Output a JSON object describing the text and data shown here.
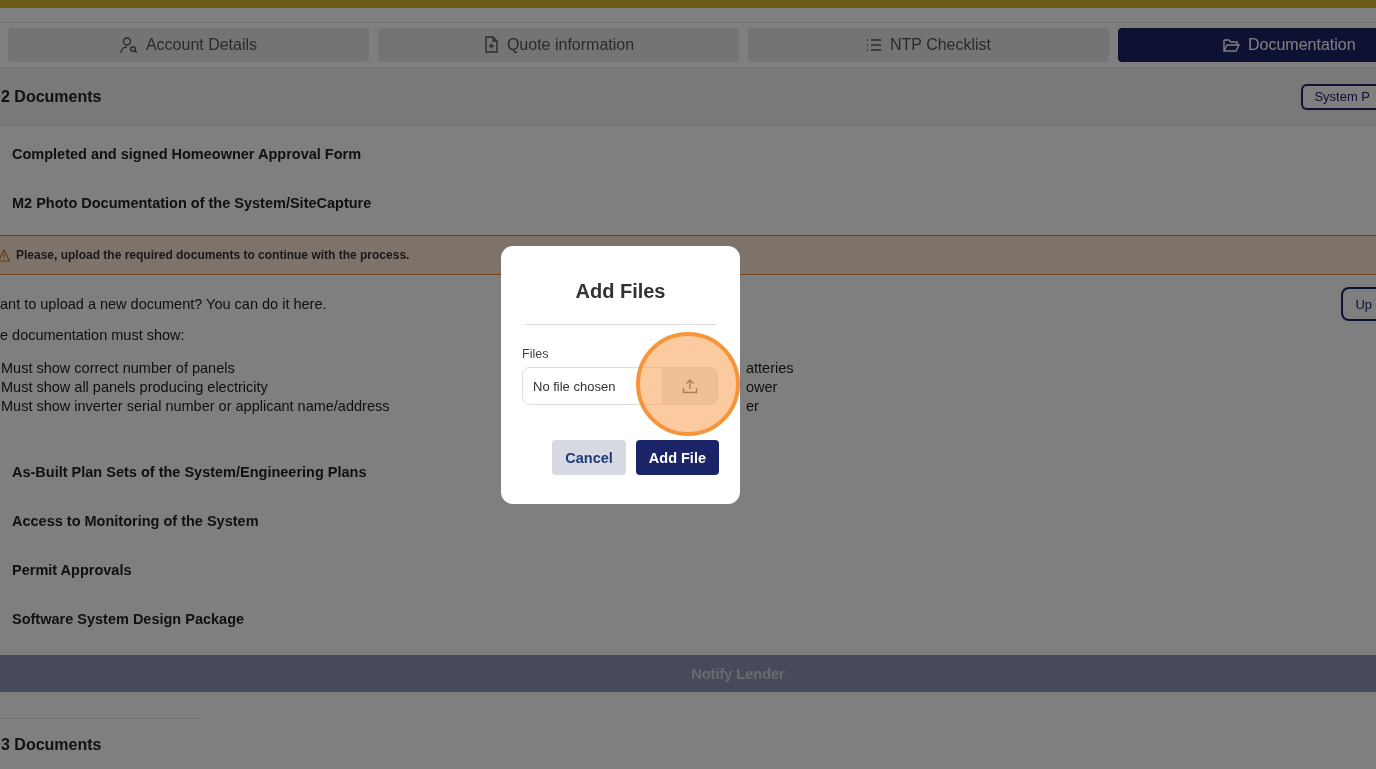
{
  "tabs": [
    {
      "label": "Account Details",
      "selected": false
    },
    {
      "label": "Quote information",
      "selected": false
    },
    {
      "label": "NTP Checklist",
      "selected": false
    },
    {
      "label": "Documentation",
      "selected": true
    }
  ],
  "section": {
    "title": "2 Documents",
    "action_button": "System P"
  },
  "documents": [
    "Completed and signed Homeowner Approval Form",
    "M2 Photo Documentation of the System/SiteCapture"
  ],
  "warning": "Please, upload the required documents to continue with the process.",
  "upload_prompt": "ant to upload a new document? You can do it here.",
  "upload_button": "Up",
  "requirements_title": "e documentation must show:",
  "requirements_left": [
    "Must show correct number of panels",
    "Must show all panels producing electricity",
    "Must show inverter serial number or applicant name/address"
  ],
  "requirements_right": [
    "atteries",
    "ower",
    "er"
  ],
  "more_documents": [
    "As-Built Plan Sets of the System/Engineering Plans",
    "Access to Monitoring of the System",
    "Permit Approvals",
    "Software System Design Package"
  ],
  "notify_button": {
    "label": "Notify Lender",
    "disabled": true
  },
  "next_section": {
    "title": "3 Documents"
  },
  "modal": {
    "title": "Add Files",
    "field_label": "Files",
    "file_status": "No file chosen",
    "buttons": [
      {
        "label": "Cancel",
        "kind": "secondary"
      },
      {
        "label": "Add File",
        "kind": "primary"
      }
    ]
  }
}
